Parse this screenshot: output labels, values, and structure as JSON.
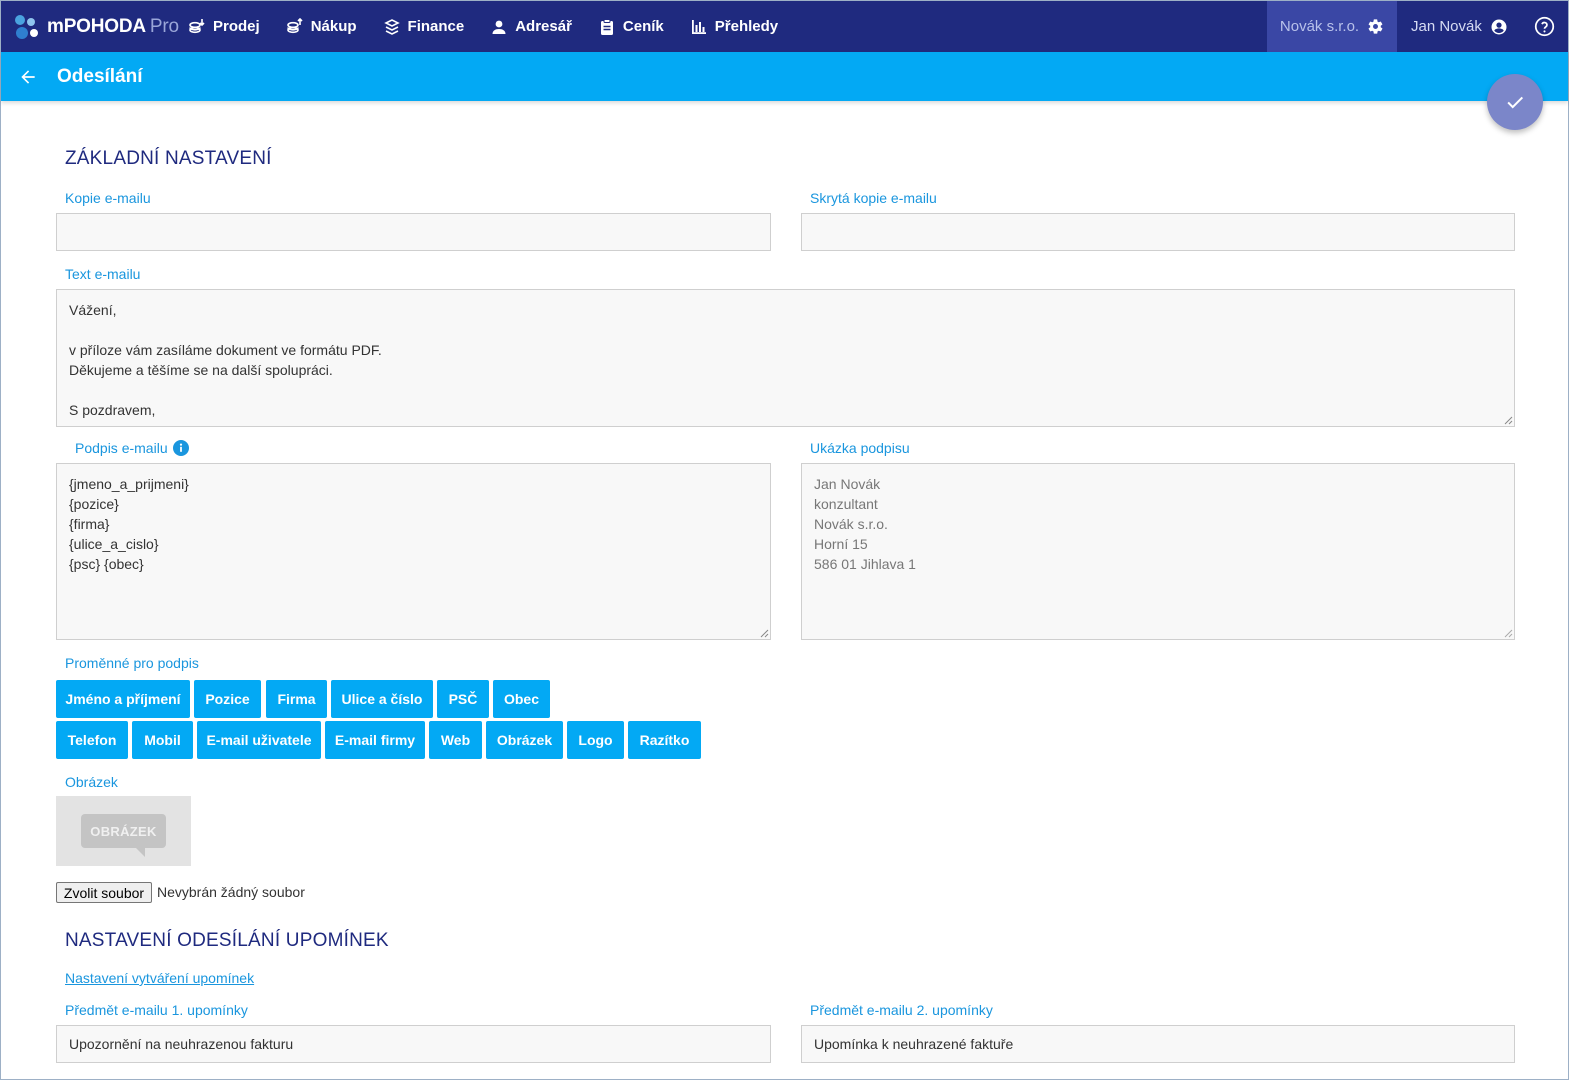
{
  "app": {
    "name": "mPOHODA",
    "edition": "Pro"
  },
  "nav": [
    {
      "label": "Prodej",
      "icon": "coins-in-icon"
    },
    {
      "label": "Nákup",
      "icon": "coins-out-icon"
    },
    {
      "label": "Finance",
      "icon": "finance-icon"
    },
    {
      "label": "Adresář",
      "icon": "person-icon"
    },
    {
      "label": "Ceník",
      "icon": "clipboard-icon"
    },
    {
      "label": "Přehledy",
      "icon": "bar-chart-icon"
    }
  ],
  "company": "Novák s.r.o.",
  "user": "Jan Novák",
  "page_title": "Odesílání",
  "basic": {
    "title": "ZÁKLADNÍ NASTAVENÍ",
    "cc_label": "Kopie e-mailu",
    "cc_value": "",
    "bcc_label": "Skrytá kopie e-mailu",
    "bcc_value": "",
    "text_label": "Text e-mailu",
    "text_value": "Vážení,\n\nv příloze vám zasíláme dokument ve formátu PDF.\nDěkujeme a těšíme se na další spolupráci.\n\nS pozdravem,",
    "signature_label": "Podpis e-mailu",
    "signature_value": "{jmeno_a_prijmeni}\n{pozice}\n{firma}\n{ulice_a_cislo}\n{psc} {obec}",
    "preview_label": "Ukázka podpisu",
    "preview_value": "Jan Novák\nkonzultant\nNovák s.r.o.\nHorní 15\n586 01 Jihlava 1",
    "variables_label": "Proměnné pro podpis",
    "variables_row1": [
      "Jméno a příjmení",
      "Pozice",
      "Firma",
      "Ulice a číslo",
      "PSČ",
      "Obec"
    ],
    "variables_row2": [
      "Telefon",
      "Mobil",
      "E-mail uživatele",
      "E-mail firmy",
      "Web",
      "Obrázek",
      "Logo",
      "Razítko"
    ],
    "image_label": "Obrázek",
    "image_placeholder": "OBRÁZEK",
    "file_button": "Zvolit soubor",
    "file_status": "Nevybrán žádný soubor"
  },
  "reminders": {
    "title": "NASTAVENÍ ODESÍLÁNÍ UPOMÍNEK",
    "link": "Nastavení vytváření upomínek",
    "subject1_label": "Předmět e-mailu 1. upomínky",
    "subject1_value": "Upozornění na neuhrazenou fakturu",
    "subject2_label": "Předmět e-mailu 2. upomínky",
    "subject2_value": "Upomínka k neuhrazené faktuře"
  },
  "colors": {
    "navbar": "#1f2a7f",
    "subbar": "#03a9f4",
    "accent": "#1a96de",
    "fab": "#7b86c9"
  }
}
